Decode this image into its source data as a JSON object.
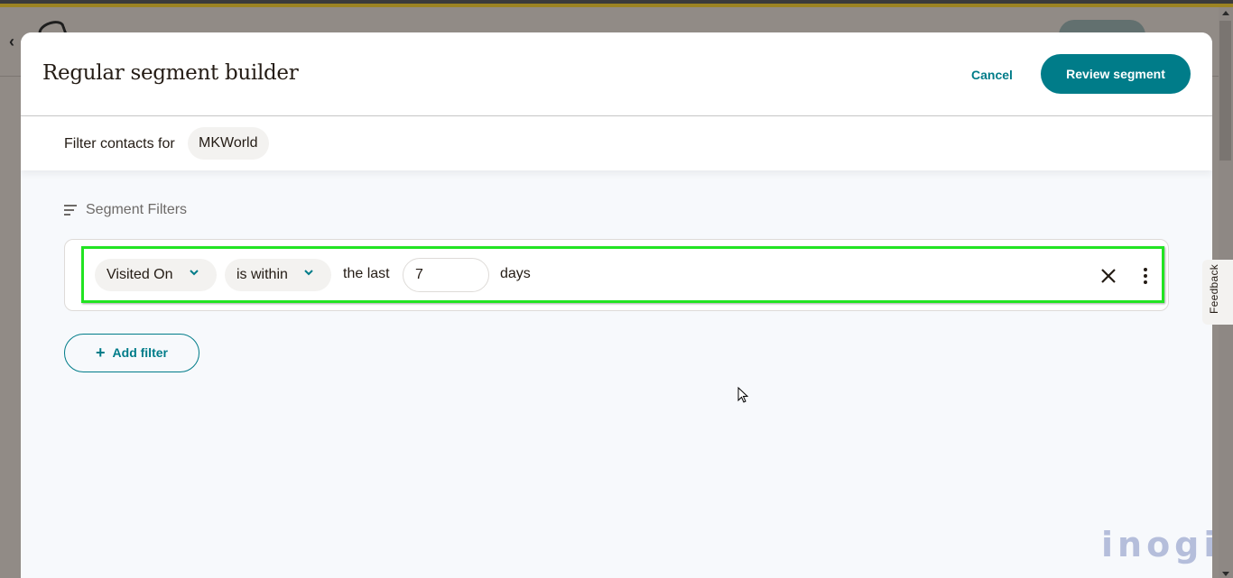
{
  "modal": {
    "title": "Regular segment builder",
    "cancel_label": "Cancel",
    "review_label": "Review segment"
  },
  "subheader": {
    "label": "Filter contacts for",
    "audience": "MKWorld"
  },
  "section": {
    "label": "Segment Filters",
    "icon": "filter-lines-icon"
  },
  "filter": {
    "field": "Visited On",
    "operator": "is within",
    "qualifier": "the last",
    "value": "7",
    "unit": "days",
    "remove_icon": "close-icon",
    "more_icon": "more-vertical-icon"
  },
  "add_filter": {
    "label": "Add filter",
    "icon": "plus-icon"
  },
  "feedback": {
    "label": "Feedback"
  },
  "watermark": {
    "text": "inogic"
  },
  "colors": {
    "accent": "#007c89",
    "highlight": "#22e422",
    "text": "#241c15"
  }
}
